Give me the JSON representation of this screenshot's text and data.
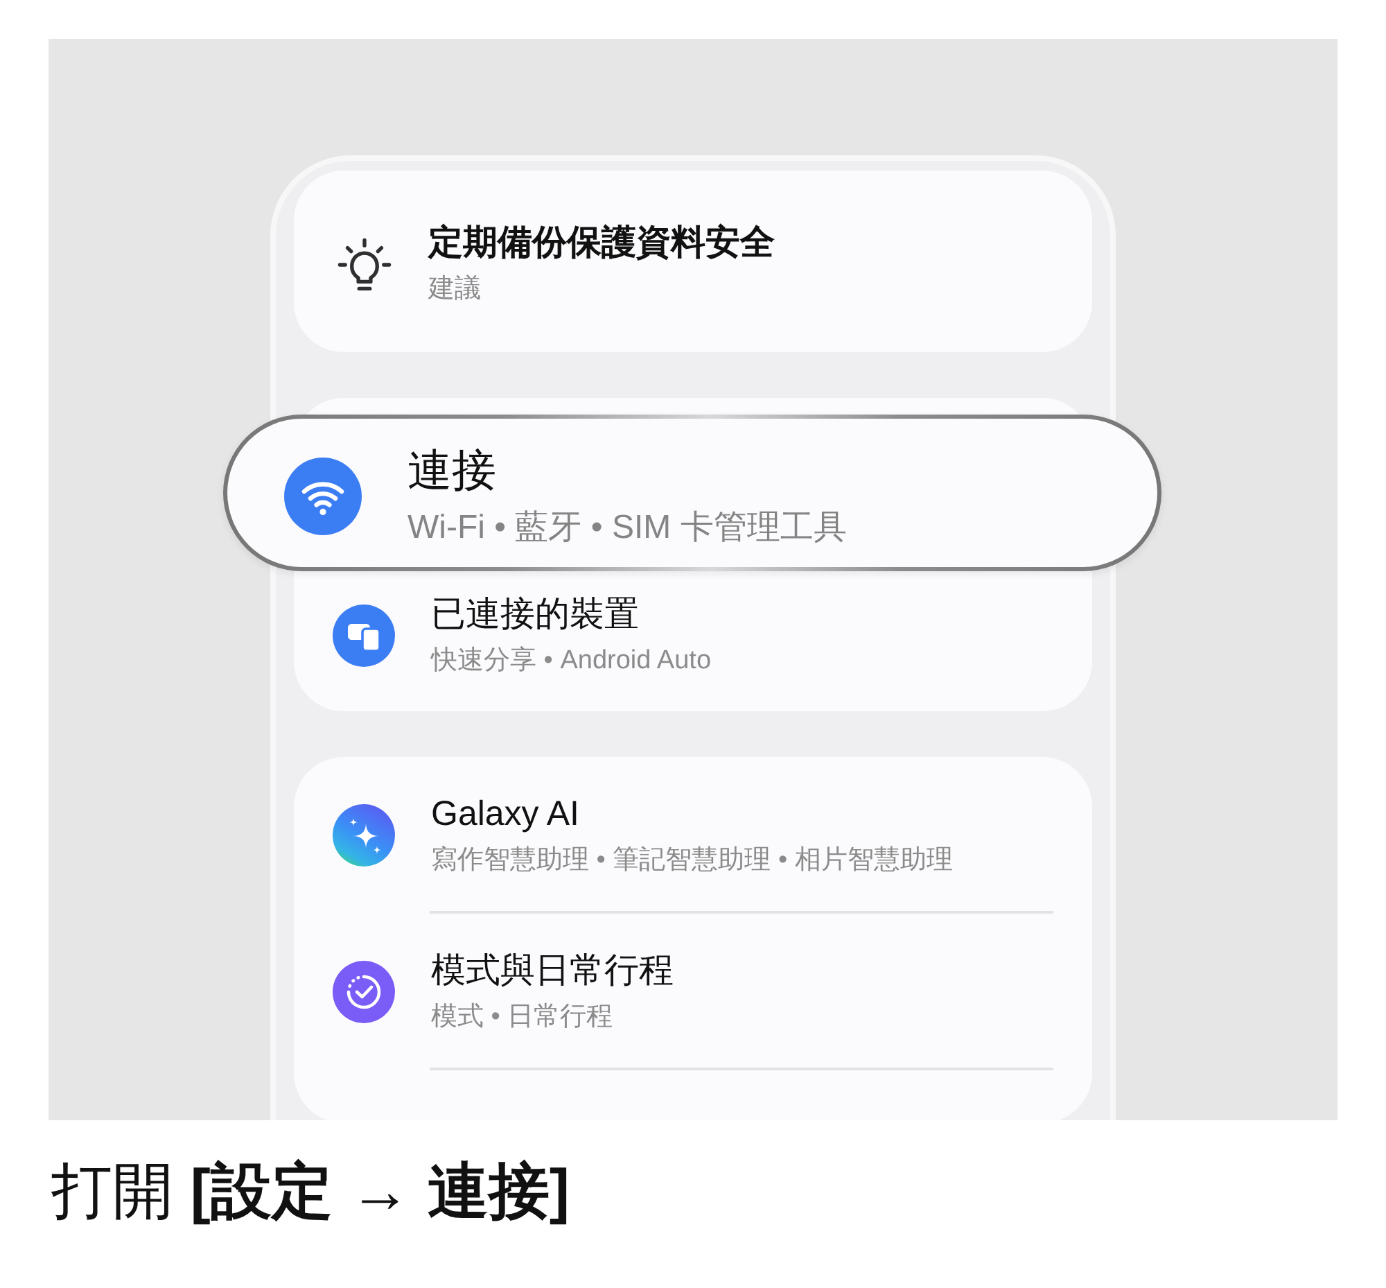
{
  "suggestion": {
    "title": "定期備份保護資料安全",
    "subtitle": "建議"
  },
  "groups": [
    {
      "more_below": false,
      "items": [
        {
          "title": "連接",
          "subtitle": "Wi-Fi • 藍牙 • SIM 卡管理工具",
          "highlighted": true
        },
        {
          "title": "已連接的裝置",
          "subtitle": "快速分享 • Android Auto",
          "highlighted": false
        }
      ]
    },
    {
      "more_below": true,
      "items": [
        {
          "title": "Galaxy AI",
          "subtitle": "寫作智慧助理 • 筆記智慧助理 • 相片智慧助理",
          "highlighted": false
        },
        {
          "title": "模式與日常行程",
          "subtitle": "模式 • 日常行程",
          "highlighted": false
        }
      ]
    }
  ],
  "caption": "打開 **[設定 → 連接]**"
}
